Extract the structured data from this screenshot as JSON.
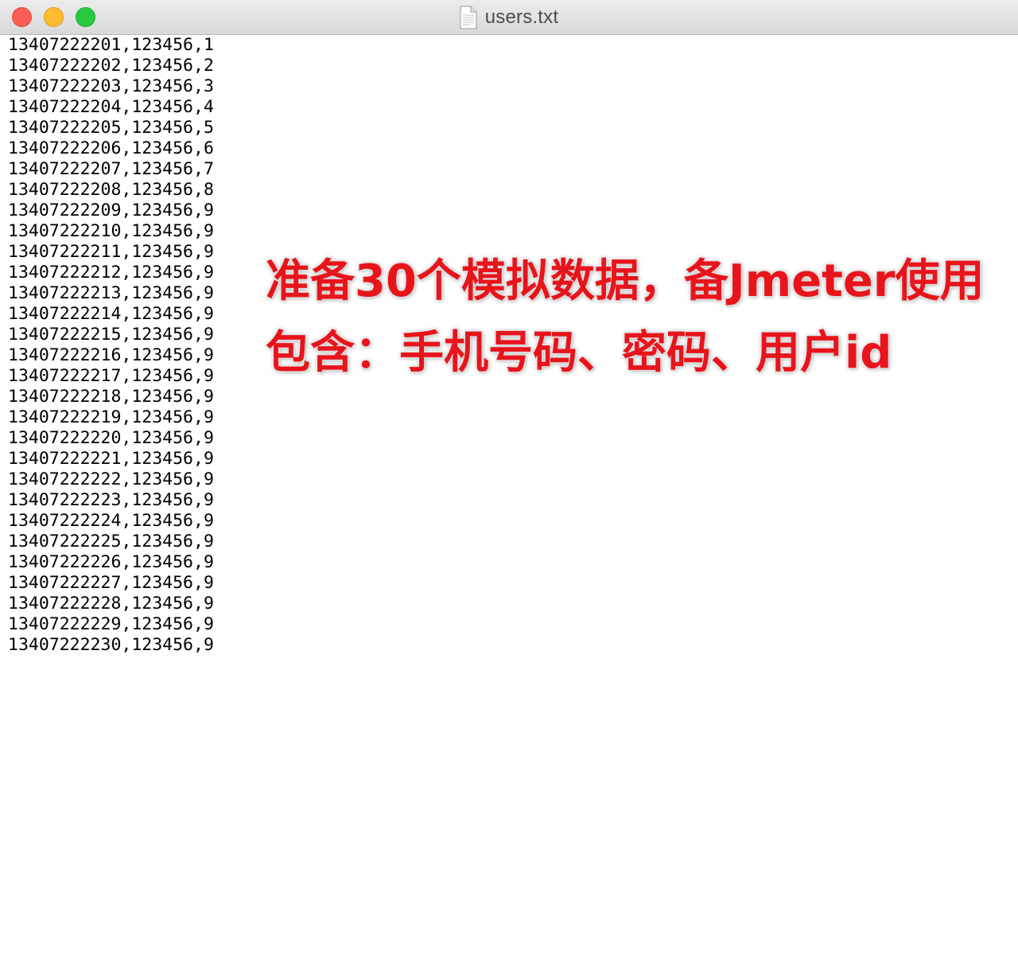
{
  "window": {
    "title": "users.txt"
  },
  "icons": {
    "close": "close-button-red",
    "minimize": "minimize-button-yellow",
    "zoom": "zoom-button-green",
    "document": "text-document-icon"
  },
  "colors": {
    "annotation": "#e8141c",
    "text": "#000000"
  },
  "lines": [
    "13407222201,123456,1",
    "13407222202,123456,2",
    "13407222203,123456,3",
    "13407222204,123456,4",
    "13407222205,123456,5",
    "13407222206,123456,6",
    "13407222207,123456,7",
    "13407222208,123456,8",
    "13407222209,123456,9",
    "13407222210,123456,9",
    "13407222211,123456,9",
    "13407222212,123456,9",
    "13407222213,123456,9",
    "13407222214,123456,9",
    "13407222215,123456,9",
    "13407222216,123456,9",
    "13407222217,123456,9",
    "13407222218,123456,9",
    "13407222219,123456,9",
    "13407222220,123456,9",
    "13407222221,123456,9",
    "13407222222,123456,9",
    "13407222223,123456,9",
    "13407222224,123456,9",
    "13407222225,123456,9",
    "13407222226,123456,9",
    "13407222227,123456,9",
    "13407222228,123456,9",
    "13407222229,123456,9",
    "13407222230,123456,9"
  ],
  "annotation": {
    "line1": "准备30个模拟数据，备Jmeter使用",
    "line2": "包含：手机号码、密码、用户id"
  }
}
